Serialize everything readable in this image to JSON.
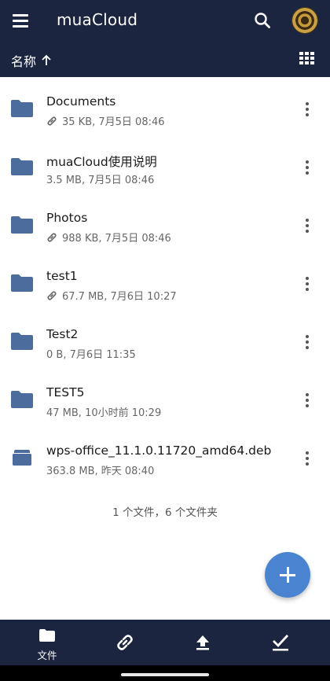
{
  "app_bar": {
    "title": "muaCloud",
    "menu_icon": "hamburger-menu-icon",
    "search_icon": "search-icon",
    "avatar": "user-avatar"
  },
  "sort_bar": {
    "sort_label": "名称",
    "sort_direction_icon": "arrow-up-icon",
    "view_toggle_icon": "grid-view-icon"
  },
  "colors": {
    "bar_background": "#1b2540",
    "folder_icon": "#4d6c9e",
    "fab": "#4a84d0"
  },
  "files": [
    {
      "name": "Documents",
      "meta": "35 KB, 7月5日 08:46",
      "shared": true,
      "type": "folder"
    },
    {
      "name": "muaCloud使用说明",
      "meta": "3.5 MB, 7月5日 08:46",
      "shared": false,
      "type": "folder"
    },
    {
      "name": "Photos",
      "meta": "988 KB, 7月5日 08:46",
      "shared": true,
      "type": "folder"
    },
    {
      "name": "test1",
      "meta": "67.7 MB, 7月6日 10:27",
      "shared": true,
      "type": "folder"
    },
    {
      "name": "Test2",
      "meta": "0 B, 7月6日 11:35",
      "shared": false,
      "type": "folder"
    },
    {
      "name": "TEST5",
      "meta": "47 MB, 10小时前 10:29",
      "shared": false,
      "type": "folder"
    },
    {
      "name": "wps-office_11.1.0.11720_amd64.deb",
      "meta": "363.8 MB, 昨天 08:40",
      "shared": false,
      "type": "package"
    }
  ],
  "summary": "1 个文件，6 个文件夹",
  "fab_icon": "add-icon",
  "bottom_tabs": [
    {
      "icon": "folder-icon",
      "label": "文件",
      "active": true
    },
    {
      "icon": "link-icon",
      "label": "",
      "active": false
    },
    {
      "icon": "upload-icon",
      "label": "",
      "active": false
    },
    {
      "icon": "checkmark-icon",
      "label": "",
      "active": false
    }
  ]
}
